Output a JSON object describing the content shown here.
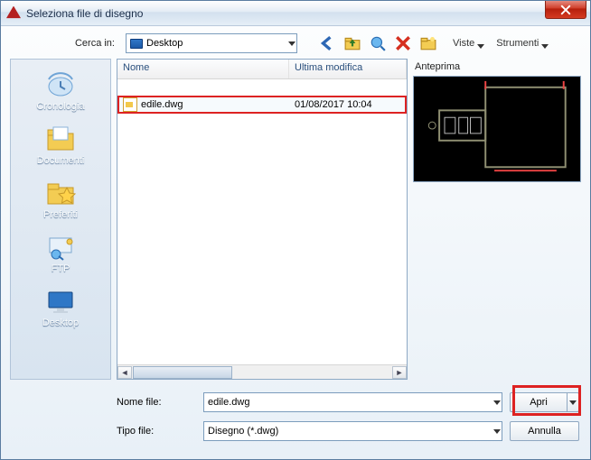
{
  "titlebar": {
    "title": "Seleziona file di disegno"
  },
  "toolbar": {
    "look_in_label": "Cerca in:",
    "look_in_value": "Desktop",
    "views_label": "Viste",
    "tools_label": "Strumenti",
    "icons": [
      "back-icon",
      "up-one-level-icon",
      "search-web-icon",
      "delete-icon",
      "new-folder-icon"
    ]
  },
  "sidebar": {
    "items": [
      {
        "label": "Cronologia"
      },
      {
        "label": "Documenti"
      },
      {
        "label": "Preferiti"
      },
      {
        "label": "FTP"
      },
      {
        "label": "Desktop"
      }
    ]
  },
  "columns": {
    "name": "Nome",
    "modified": "Ultima modifica"
  },
  "files": [
    {
      "name": "edile.dwg",
      "modified": "01/08/2017 10:04",
      "selected": true
    }
  ],
  "preview": {
    "label": "Anteprima"
  },
  "fields": {
    "filename_label": "Nome file:",
    "filename_value": "edile.dwg",
    "filetype_label": "Tipo file:",
    "filetype_value": "Disegno (*.dwg)"
  },
  "buttons": {
    "open": "Apri",
    "cancel": "Annulla"
  }
}
